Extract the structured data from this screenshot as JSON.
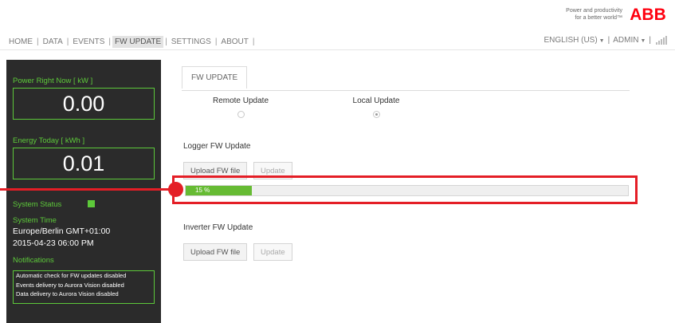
{
  "brand": {
    "tagline_line1": "Power and productivity",
    "tagline_line2": "for a better world™",
    "logo_text": "ABB",
    "logo_color": "#ff000f"
  },
  "nav": {
    "items": [
      "HOME",
      "DATA",
      "EVENTS",
      "FW UPDATE",
      "SETTINGS",
      "ABOUT"
    ],
    "active": "FW UPDATE",
    "separator": "|",
    "language": "ENGLISH (US)",
    "user": "ADMIN"
  },
  "sidebar": {
    "power_label": "Power Right Now [ kW ]",
    "power_value": "0.00",
    "energy_label": "Energy Today [ kWh ]",
    "energy_value": "0.01",
    "system_status_label": "System Status",
    "system_time_label": "System Time",
    "timezone": "Europe/Berlin GMT+01:00",
    "datetime": "2015-04-23 06:00 PM",
    "notifications_label": "Notifications",
    "notifications": [
      "Automatic check for FW updates disabled",
      "Events delivery to Aurora Vision disabled",
      "Data delivery to Aurora Vision disabled"
    ],
    "accent_color": "#5dc93a"
  },
  "main": {
    "tab_label": "FW UPDATE",
    "remote_update_label": "Remote Update",
    "local_update_label": "Local Update",
    "selected_mode": "Local Update",
    "logger_title": "Logger FW Update",
    "inverter_title": "Inverter FW Update",
    "upload_label": "Upload FW file",
    "update_label": "Update",
    "progress_text": "15 %",
    "progress_value": 0.15,
    "progress_color": "#66bb33"
  },
  "annotation": {
    "highlight_color": "#e41e26"
  }
}
